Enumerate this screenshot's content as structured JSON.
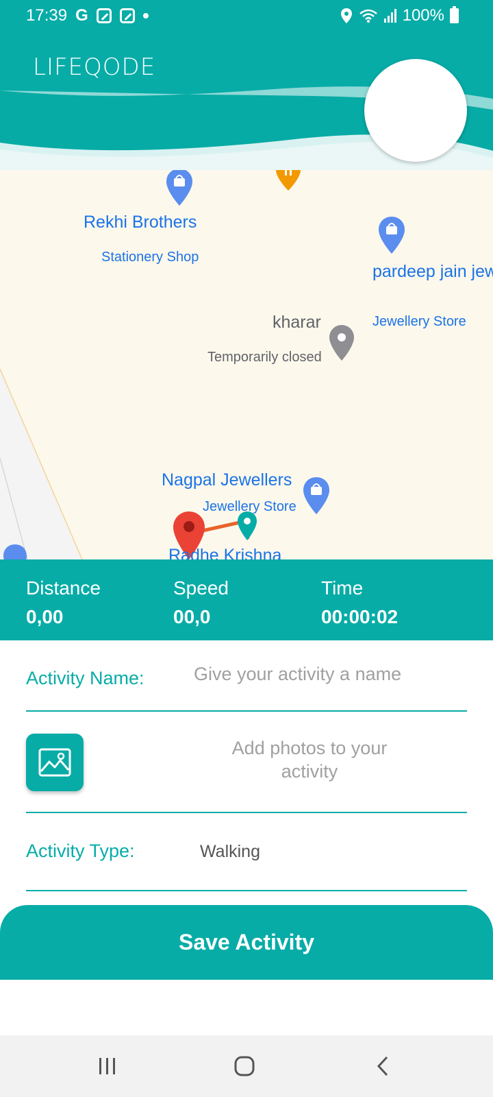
{
  "status_bar": {
    "time": "17:39",
    "g_icon": "G",
    "battery": "100%"
  },
  "header": {
    "logo": "LIFEQODE"
  },
  "map": {
    "places": [
      {
        "name": "Rekhi Brothers",
        "category": "Stationery Shop"
      },
      {
        "name": "pardeep jain jew",
        "category": "Jewellery Store"
      },
      {
        "name": "kharar",
        "category": "Temporarily closed"
      },
      {
        "name": "Nagpal Jewellers",
        "category": "Jewellery Store"
      },
      {
        "name": "Radhe Krishna",
        "category": ""
      }
    ]
  },
  "stats": {
    "distance_label": "Distance",
    "distance_value": "0,00",
    "speed_label": "Speed",
    "speed_value": "00,0",
    "time_label": "Time",
    "time_value": "00:00:02"
  },
  "form": {
    "activity_name_label": "Activity Name:",
    "activity_name_placeholder": "Give your activity a name",
    "photos_text": "Add photos to your activity",
    "activity_type_label": "Activity Type:",
    "activity_type_value": "Walking",
    "save_button": "Save Activity"
  },
  "colors": {
    "brand": "#07aca7",
    "map_bg": "#fdf8ec",
    "place_blue": "#1a73e8",
    "pin_red": "#ea4335"
  },
  "icons": [
    "gallery-icon",
    "location-icon",
    "wifi-icon",
    "signal-icon",
    "battery-icon",
    "recents-icon",
    "home-icon",
    "back-icon"
  ]
}
